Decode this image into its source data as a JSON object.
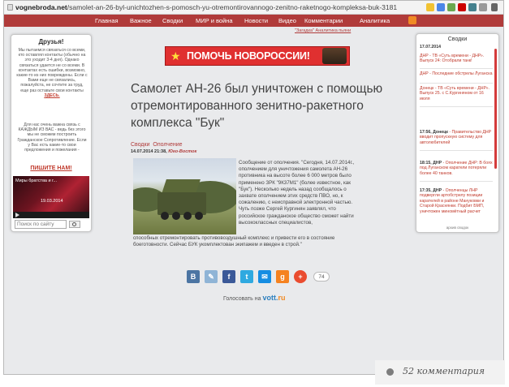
{
  "browser": {
    "url_domain": "vognebroda.net",
    "url_path": "/samolet-an-26-byl-unichtozhen-s-pomosch-yu-otremontirovannogo-zenitno-raketnogo-kompleksa-buk-31818"
  },
  "nav": {
    "items": [
      "Главная",
      "Важное",
      "Сводки",
      "МИР и война",
      "Новости",
      "Видео",
      "Комментарии",
      "Аналитика"
    ]
  },
  "top_link": "\"Загадка\" Аналитика пьяни",
  "left_widget": {
    "title": "Друзья!",
    "text1": "Мы пытаемся связаться со всеми, кто оставлял контакты (обычно на это уходит 3-4 дня). Однако связаться удается не со всеми. В контактах есть ошибки, возможно, какие-то из них повреждены. Если с Вами еще не связались, пожалуйста, не сочтите за труд, еще раз оставьте свои контакты",
    "link": "ЗДЕСЬ.",
    "text2": "Для нас очень важна связь с КАЖДЫМ ИЗ ВАС - ведь без этого мы не сможем построить Гражданское Сопротивление. Если у Вас есть какие-то свои предложения и пожелания -",
    "big_link": "ПИШИТЕ НАМ!",
    "video_title": "Миры братства и г...",
    "video_date": "19.03.2014",
    "search_placeholder": "Поиск по сайту"
  },
  "banner": {
    "text": "ПОМОЧЬ НОВОРОССИИ!",
    "star": "★",
    "color": "#e03030"
  },
  "article": {
    "headline": "Самолет АН-26 был уничтожен с помощью отремонтированного зенитно-ракетного комплекса \"Бук\"",
    "tag1": "Сводки",
    "tag2": "Ополчение",
    "date": "14.07.2014 21:38,",
    "source": "Юго-Восток",
    "body1": "Сообщение от ополчения. \"Сегодня, 14.07.2014г., ополчением для уничтожения самолета АН-26 противника на высоте более 6 000 метров было применено ЗРК \"9К37М1\" (более известное, как \"Бук\"). Несколько недель назад сообщалось о захвате ополчением этих средств ПВО, но, к сожалению, с неисправной электронной частью. Чуть позже Сергей Кургинян заявлял, что российское гражданское общество сможет найти высококлассных специалистов,",
    "body2": "способных отремонтировать противовоздушный комплекс и привести его в состояние боеготовности. Сейчас БУК укомплектован экипажем и введен в строй.\""
  },
  "share": {
    "buttons": [
      "В",
      "✎",
      "f",
      "t",
      "✉",
      "g",
      "+"
    ],
    "count": "74",
    "vote_label": "Голосовать на",
    "vote_site": "vott.",
    "vote_ru": "ru"
  },
  "right_widget": {
    "title": "Сводки",
    "items": [
      {
        "date": "17.07.2014",
        "text": ""
      },
      {
        "date": "",
        "text": "ДНР - ТВ «Суть времени - ДНР». Выпуск 24: Отобрали танк!"
      },
      {
        "date": "",
        "text": "ДНР - Последние обстрелы Луганска"
      },
      {
        "date": "",
        "text": "Донецк - ТВ «Суть времени - ДНР». Выпуск 25. с С.Кургиняном от 16 июля"
      },
      {
        "date": "17:56, Донецк",
        "text": "- Правительство ДНР вводит пропускную систему для автолюбителей"
      },
      {
        "date": "18:15, ДНР",
        "text": "- Ополчение ДНР: В боях под Луганском каратели потеряли более 40 танков."
      },
      {
        "date": "17:35, ДНР",
        "text": "- Ополченцы ЛНР подвергли артобстрелу позиции карателей в районе Мануковки и Старой Краснянки. Подбит БМП, уничтожен миномётный расчет"
      }
    ],
    "footer": "архив сводок"
  },
  "comments_badge": "52 комментария"
}
